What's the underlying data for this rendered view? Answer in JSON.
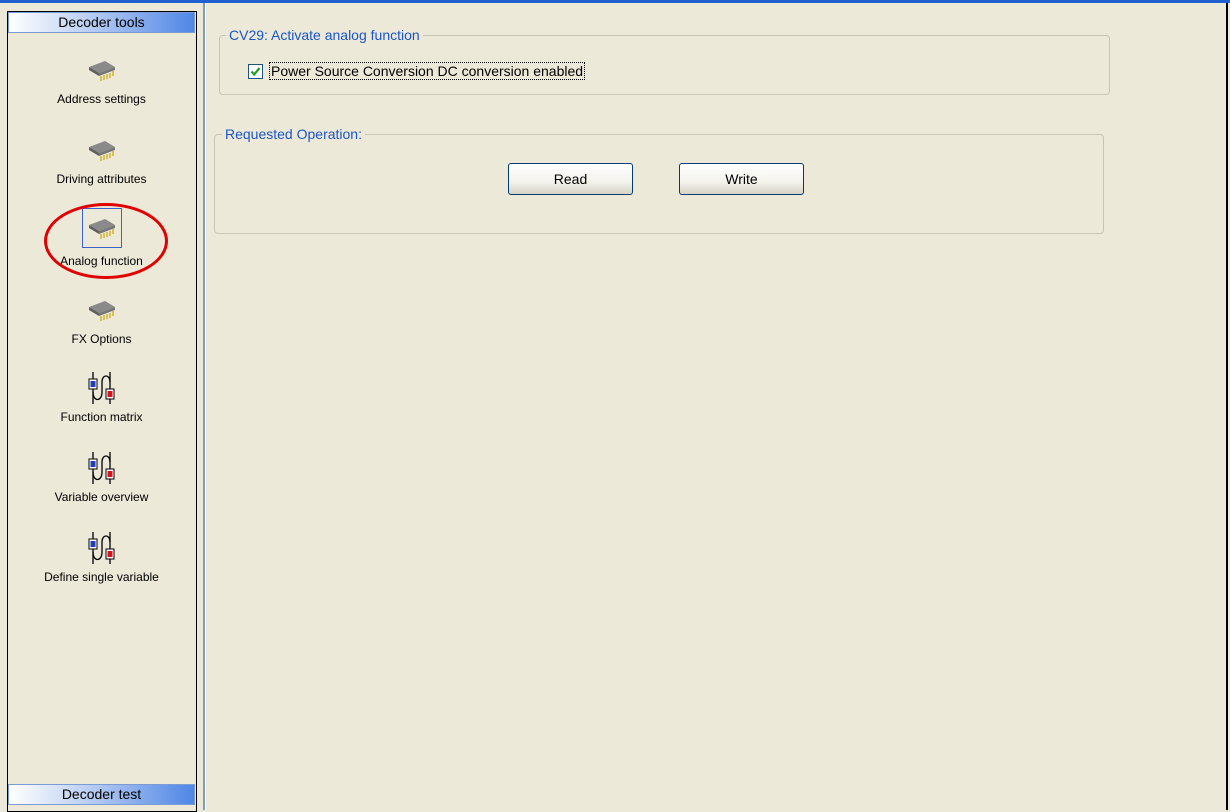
{
  "sidebar": {
    "header_top": "Decoder tools",
    "header_bottom": "Decoder test",
    "items": [
      {
        "label": "Address settings",
        "icon": "chip-icon"
      },
      {
        "label": "Driving attributes",
        "icon": "chip-icon"
      },
      {
        "label": "Analog function",
        "icon": "chip-icon",
        "selected": true
      },
      {
        "label": "FX Options",
        "icon": "chip-icon"
      },
      {
        "label": "Function matrix",
        "icon": "mixer-ab-icon"
      },
      {
        "label": "Variable overview",
        "icon": "mixer-ab-icon"
      },
      {
        "label": "Define single variable",
        "icon": "mixer-ab-icon"
      }
    ]
  },
  "main": {
    "cv29_group": {
      "title": "CV29: Activate analog function",
      "checkbox_label": "Power Source Conversion DC conversion enabled",
      "checked": true
    },
    "operation_group": {
      "title": "Requested Operation:",
      "read_label": "Read",
      "write_label": "Write"
    }
  },
  "colors": {
    "group_title": "#1a55c8",
    "annotation_circle": "#e00000",
    "checkmark": "#2a9d2a"
  }
}
